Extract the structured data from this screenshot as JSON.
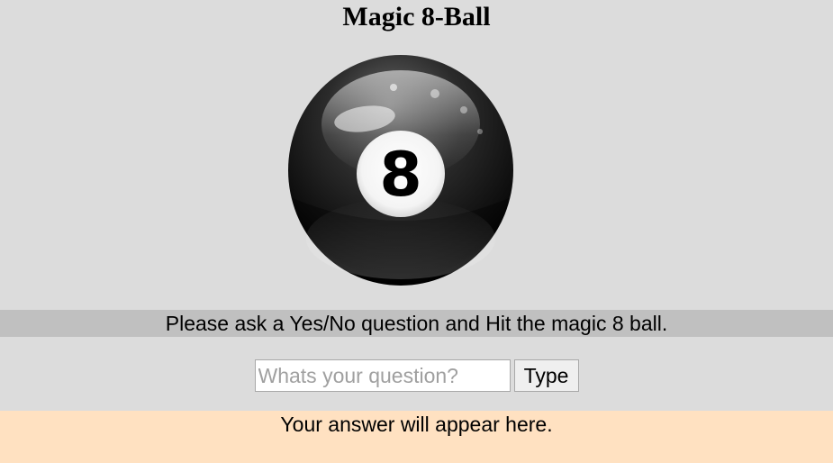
{
  "page": {
    "title": "Magic 8-Ball"
  },
  "ball": {
    "number": "8",
    "icon": "magic-8-ball-icon"
  },
  "instruction": {
    "text": "Please ask a Yes/No question and Hit the magic 8 ball."
  },
  "question_form": {
    "input_value": "",
    "input_placeholder": "Whats your question?",
    "button_label": "Type"
  },
  "answer": {
    "text": "Your answer will appear here."
  },
  "colors": {
    "background": "#dcdcdc",
    "instruction_bar": "#c0c0c0",
    "answer_background": "#ffe1c1"
  }
}
